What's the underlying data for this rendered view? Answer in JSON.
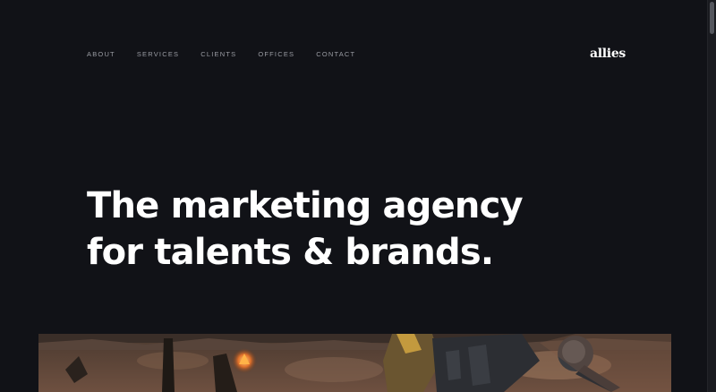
{
  "nav": {
    "items": [
      {
        "label": "ABOUT"
      },
      {
        "label": "SERVICES"
      },
      {
        "label": "CLIENTS"
      },
      {
        "label": "OFFICES"
      },
      {
        "label": "CONTACT"
      }
    ]
  },
  "logo": {
    "text": "allies"
  },
  "hero": {
    "line1": "The marketing agency",
    "line2": "for talents & brands."
  },
  "colors": {
    "background": "#111217",
    "text": "#ffffff",
    "nav_text": "#9a9ca3"
  },
  "icons": {
    "media": "hero-video-still"
  }
}
